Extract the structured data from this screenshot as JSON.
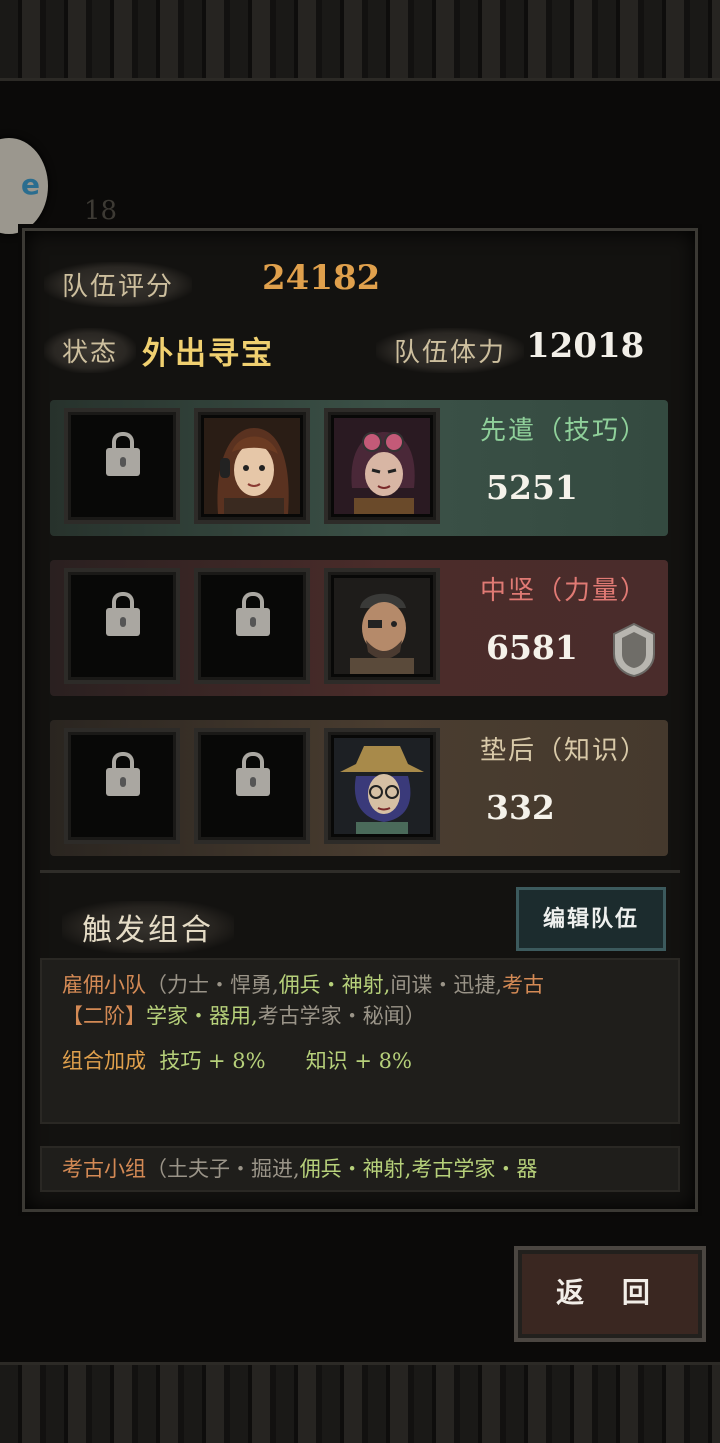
{
  "header": {
    "team_score_label": "队伍评分",
    "team_score_value": "24182",
    "status_label": "状态",
    "status_value": "外出寻宝",
    "stamina_label": "队伍体力",
    "stamina_value": "12018"
  },
  "rows": [
    {
      "role": "先遣（技巧）",
      "power": "5251"
    },
    {
      "role": "中坚（力量）",
      "power": "6581"
    },
    {
      "role": "垫后（知识）",
      "power": "332"
    }
  ],
  "combo": {
    "title": "触发组合",
    "edit_button": "编辑队伍",
    "combo1": {
      "name": "雇佣小队",
      "part1": "（力士・悍勇,",
      "part2": "佣兵・神射,",
      "part3": "间谍・迅捷,",
      "part4": "考古",
      "tier": "【二阶】",
      "part5": "学家・器用,",
      "part6": "考古学家・秘闻）"
    },
    "bonus_label": "组合加成",
    "bonus1": "技巧 + 8%",
    "bonus2": "知识 + 8%",
    "combo2": {
      "name": "考古小组",
      "part1": "（土夫子・掘进,",
      "part2": "佣兵・神射,",
      "part3": "考古学家・器"
    }
  },
  "back_button": "返 回",
  "bg_number": "18",
  "colors": {
    "front_row": "#3b5147",
    "mid_row": "#4b2c2a",
    "back_row": "#4a3d30",
    "accent_gold": "#e0a04c"
  }
}
